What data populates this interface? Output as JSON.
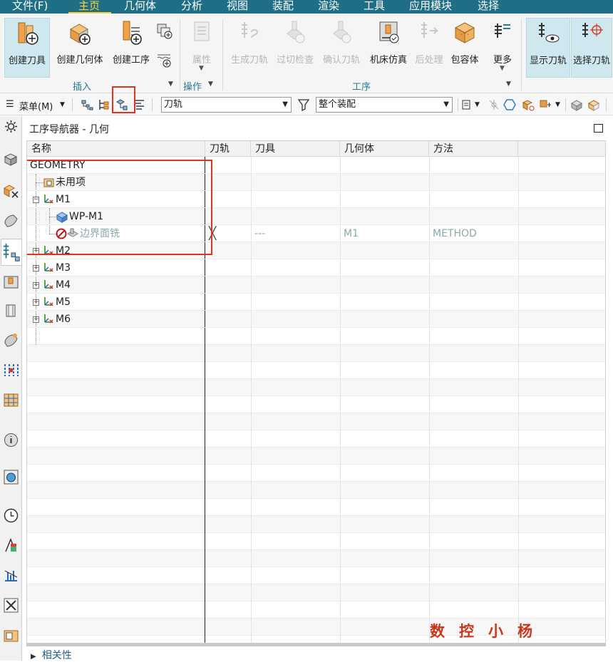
{
  "menubar": {
    "items": [
      "文件(F)",
      "主页",
      "几何体",
      "分析",
      "视图",
      "装配",
      "渲染",
      "工具",
      "应用模块",
      "选择"
    ],
    "active": "主页",
    "bg_color": "#1e6e86",
    "active_color": "#ffd23a"
  },
  "ribbon": {
    "insert": {
      "create_tool": "创建刀具",
      "create_geometry": "创建几何体",
      "create_operation": "创建工序",
      "group_label": "插入"
    },
    "operation": {
      "properties": "属性",
      "group_label": "操作"
    },
    "procedure": {
      "generate_toolpath": "生成刀轨",
      "gouge_check": "过切检查",
      "verify_toolpath": "确认刀轨",
      "machine_simulation": "机床仿真",
      "postprocess": "后处理",
      "blank": "包容体",
      "more": "更多",
      "group_label": "工序"
    },
    "display": {
      "show_toolpath": "显示刀轨",
      "select_toolpath": "选择刀轨"
    }
  },
  "toolbar": {
    "menu_label": "菜单(M)",
    "filter_select": "刀轨",
    "assembly_select": "整个装配"
  },
  "navigator": {
    "title": "工序导航器 - 几何",
    "columns": [
      "名称",
      "刀轨",
      "刀具",
      "几何体",
      "方法"
    ],
    "rows": [
      {
        "name": "GEOMETRY",
        "toolpath": "",
        "tool": "",
        "geometry": "",
        "method": ""
      },
      {
        "name": "未用项",
        "toolpath": "",
        "tool": "",
        "geometry": "",
        "method": ""
      },
      {
        "name": "M1",
        "toolpath": "",
        "tool": "",
        "geometry": "",
        "method": ""
      },
      {
        "name": "WP-M1",
        "toolpath": "",
        "tool": "",
        "geometry": "",
        "method": ""
      },
      {
        "name": "边界面铣",
        "toolpath": "╳",
        "tool": "---",
        "geometry": "M1",
        "method": "METHOD"
      },
      {
        "name": "M2",
        "toolpath": "",
        "tool": "",
        "geometry": "",
        "method": ""
      },
      {
        "name": "M3",
        "toolpath": "",
        "tool": "",
        "geometry": "",
        "method": ""
      },
      {
        "name": "M4",
        "toolpath": "",
        "tool": "",
        "geometry": "",
        "method": ""
      },
      {
        "name": "M5",
        "toolpath": "",
        "tool": "",
        "geometry": "",
        "method": ""
      },
      {
        "name": "M6",
        "toolpath": "",
        "tool": "",
        "geometry": "",
        "method": ""
      }
    ],
    "related_panel": "相关性"
  },
  "watermark": "数控小杨",
  "highlight_color": "#e2341d"
}
